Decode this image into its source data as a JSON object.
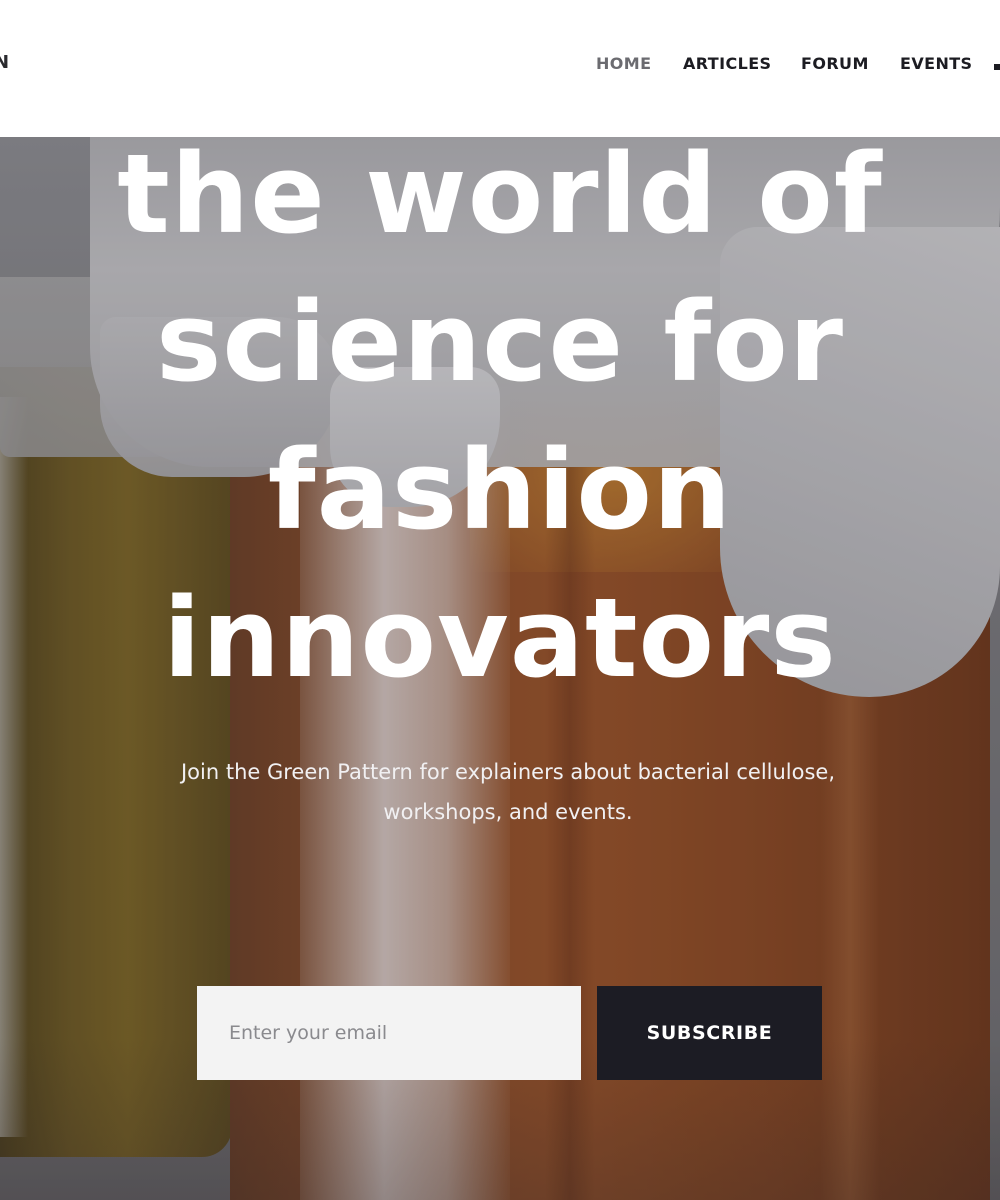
{
  "header": {
    "logo_fragment": "N",
    "nav": [
      {
        "label": "HOME",
        "active": true
      },
      {
        "label": "ARTICLES",
        "active": false
      },
      {
        "label": "FORUM",
        "active": false
      },
      {
        "label": "EVENTS",
        "active": false
      }
    ]
  },
  "hero": {
    "headline_lines": [
      "the world of",
      "science for",
      "fashion",
      "innovators"
    ],
    "subtitle_lines": [
      "Join the Green Pattern for explainers about bacterial cellulose,",
      "workshops, and events."
    ],
    "signup": {
      "email_placeholder": "Enter your email",
      "button_label": "SUBSCRIBE"
    }
  },
  "colors": {
    "header_bg": "#ffffff",
    "nav_text": "#1c1c22",
    "nav_active": "#6b6b70",
    "button_bg": "#1c1c24",
    "input_bg": "#f3f3f3"
  }
}
